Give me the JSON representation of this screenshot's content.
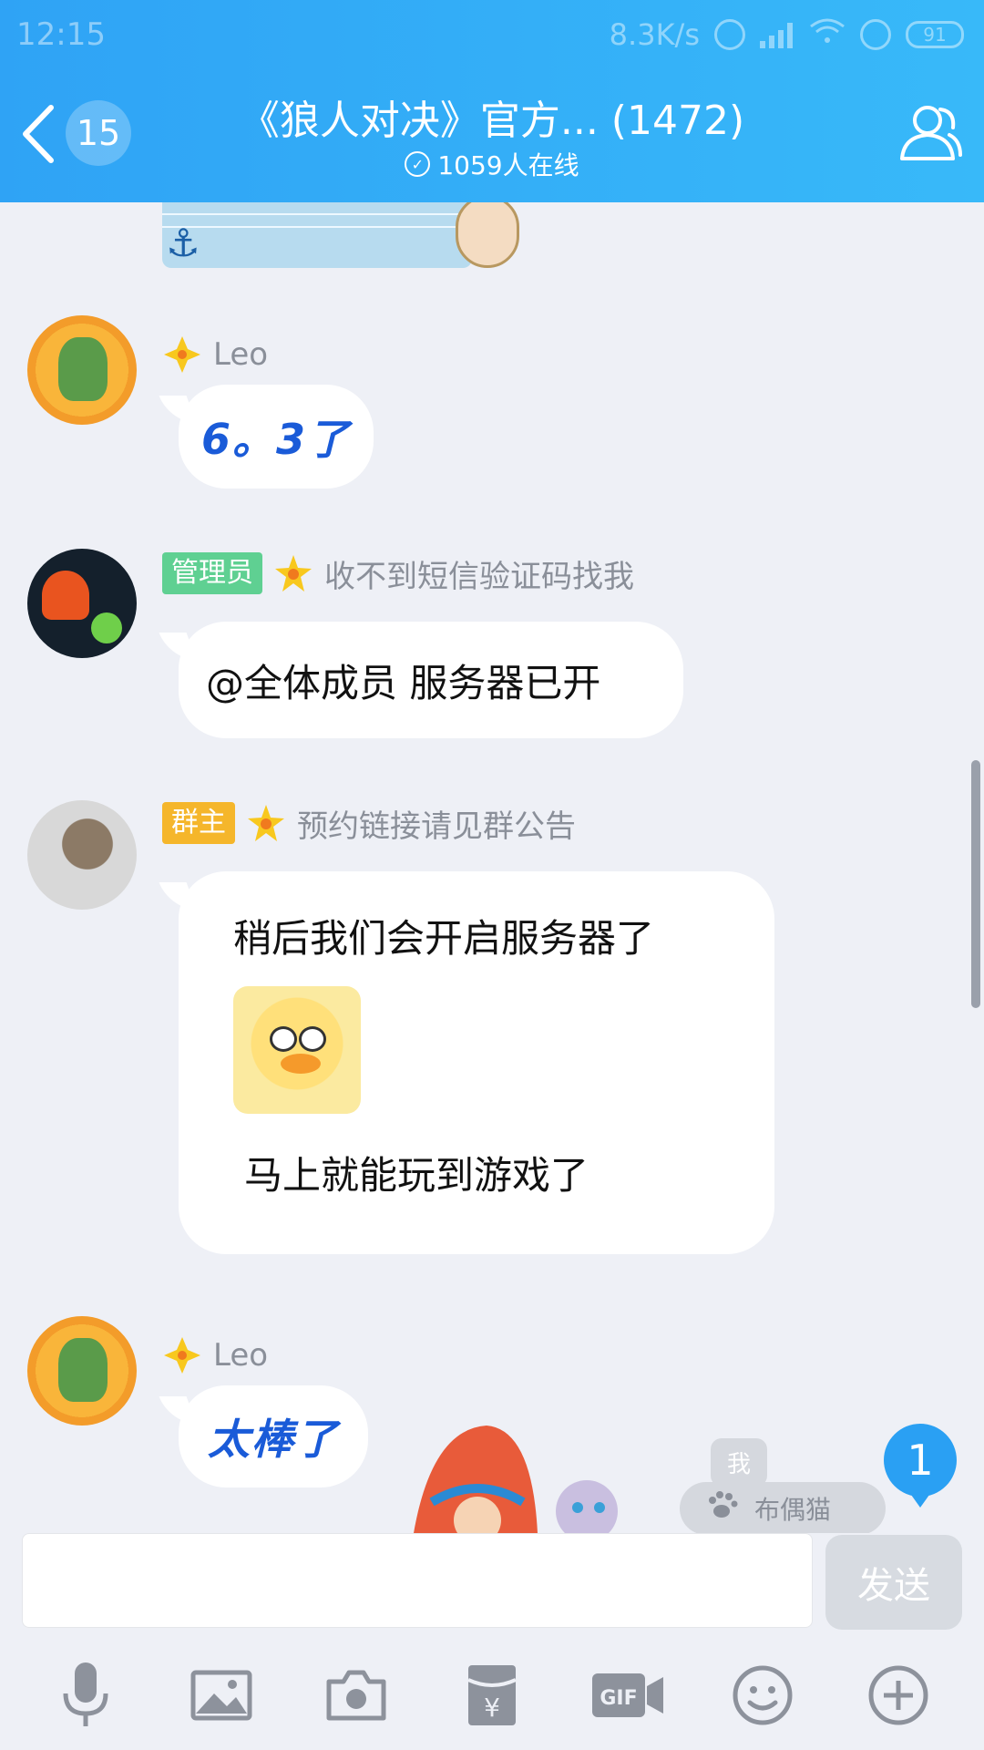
{
  "status_bar": {
    "time": "12:15",
    "speed": "8.3K/s",
    "battery": "91"
  },
  "header": {
    "unread_count": "15",
    "title": "《狼人对决》官方... (1472)",
    "online": "1059人在线"
  },
  "messages": [
    {
      "sender": "Leo",
      "text": "6。3了"
    },
    {
      "role": "管理员",
      "sender": "收不到短信验证码找我",
      "text": "@全体成员 服务器已开"
    },
    {
      "role": "群主",
      "sender": "预约链接请见群公告",
      "line1": "稍后我们会开启服务器了",
      "line2": "马上就能玩到游戏了"
    },
    {
      "sender": "Leo",
      "text": "太棒了"
    }
  ],
  "floating": {
    "me_label": "我",
    "bottle_label": "布偶猫",
    "new_message_count": "1"
  },
  "input": {
    "placeholder": "",
    "send_label": "发送"
  },
  "toolbar_icons": [
    "microphone-icon",
    "image-icon",
    "camera-icon",
    "red-packet-icon",
    "gif-icon",
    "emoji-icon",
    "plus-icon"
  ],
  "colors": {
    "header": "#2fa3f5",
    "admin_badge": "#5fd092",
    "owner_badge": "#f5b62b",
    "blue_text": "#1a5bd8"
  }
}
